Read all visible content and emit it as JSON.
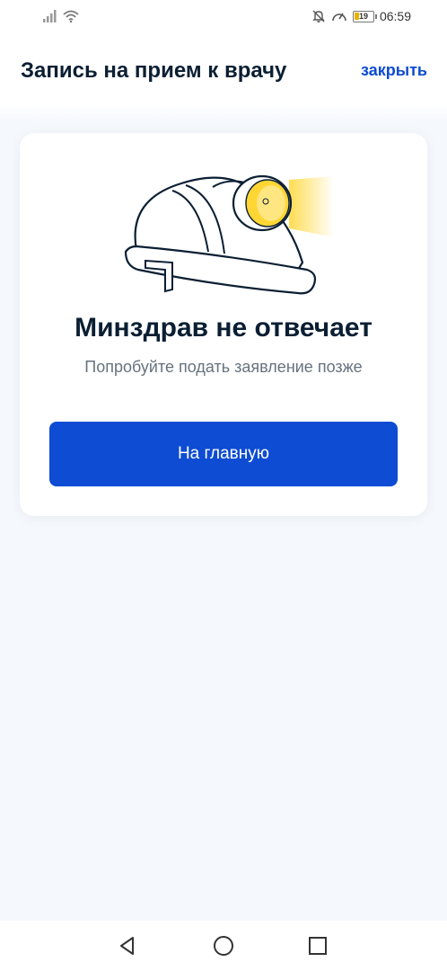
{
  "status_bar": {
    "time": "06:59",
    "battery_level": "19",
    "icons": [
      "signal-icon",
      "wifi-icon",
      "notifications-off-icon",
      "speedometer-icon",
      "battery-icon"
    ]
  },
  "header": {
    "title": "Запись на прием к врачу",
    "close_label": "закрыть"
  },
  "card": {
    "illustration": "miner-helmet-with-headlamp",
    "title": "Минздрав не отвечает",
    "subtitle": "Попробуйте подать заявление позже",
    "button_label": "На главную"
  },
  "colors": {
    "accent": "#0d4cd3",
    "title": "#0b1f33",
    "subtitle": "#66727f",
    "background": "#f5f8fc",
    "lamp": "#ffd633"
  },
  "nav_bar": {
    "buttons": [
      "back-icon",
      "home-icon",
      "recents-icon"
    ]
  }
}
